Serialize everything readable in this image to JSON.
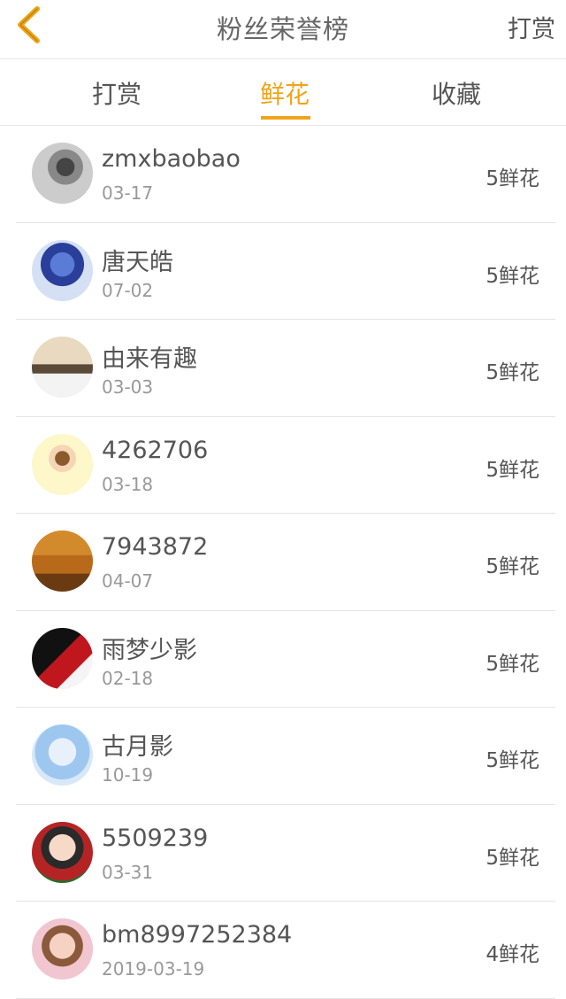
{
  "header": {
    "title": "粉丝荣誉榜",
    "action_label": "打赏",
    "accent_color": "#f0a418"
  },
  "tabs": [
    {
      "label": "打赏",
      "active": false
    },
    {
      "label": "鲜花",
      "active": true
    },
    {
      "label": "收藏",
      "active": false
    }
  ],
  "fans": [
    {
      "name": "zmxbaobao",
      "date": "03-17",
      "count": "5鲜花"
    },
    {
      "name": "唐天皓",
      "date": "07-02",
      "count": "5鲜花"
    },
    {
      "name": "由来有趣",
      "date": "03-03",
      "count": "5鲜花"
    },
    {
      "name": "4262706",
      "date": "03-18",
      "count": "5鲜花"
    },
    {
      "name": "7943872",
      "date": "04-07",
      "count": "5鲜花"
    },
    {
      "name": "雨梦少影",
      "date": "02-18",
      "count": "5鲜花"
    },
    {
      "name": "古月影",
      "date": "10-19",
      "count": "5鲜花"
    },
    {
      "name": "5509239",
      "date": "03-31",
      "count": "5鲜花"
    },
    {
      "name": "bm8997252384",
      "date": "2019-03-19",
      "count": "4鲜花"
    }
  ]
}
